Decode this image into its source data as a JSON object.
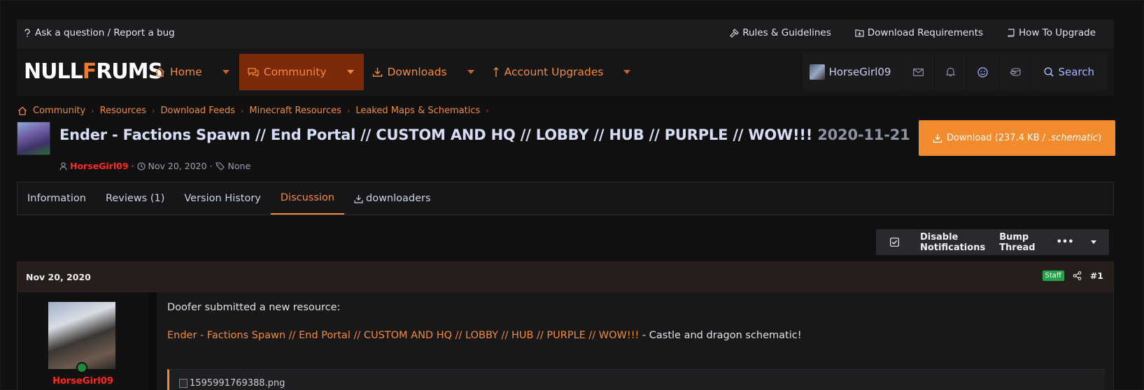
{
  "topbar": {
    "ask": "Ask a question / Report a bug",
    "links": [
      "Rules & Guidelines",
      "Download Requirements",
      "How To Upgrade"
    ]
  },
  "logo": {
    "part1": "NULL",
    "part2": "F",
    "part3": "RUMS"
  },
  "nav": {
    "items": [
      {
        "label": "Home"
      },
      {
        "label": "Community"
      },
      {
        "label": "Downloads"
      },
      {
        "label": "Account Upgrades"
      }
    ],
    "username": "HorseGirl09",
    "search": "Search"
  },
  "breadcrumb": [
    "Community",
    "Resources",
    "Download Feeds",
    "Minecraft Resources",
    "Leaked Maps & Schematics"
  ],
  "resource": {
    "title": "Ender - Factions Spawn // End Portal // CUSTOM AND HQ // LOBBY // HUB // PURPLE // WOW!!!",
    "version": "2020-11-21",
    "author": "HorseGirl09",
    "date": "Nov 20, 2020",
    "tags": "None",
    "download_prefix": "Download (237.4 KB / ",
    "download_ext": ".schematic",
    "download_suffix": ")"
  },
  "tabs": [
    "Information",
    "Reviews (1)",
    "Version History",
    "Discussion",
    "downloaders"
  ],
  "actions": {
    "disable": "Disable Notifications",
    "bump": "Bump Thread",
    "more": "•••"
  },
  "post": {
    "date": "Nov 20, 2020",
    "badge": "Staff",
    "number": "#1",
    "author": "HorseGirl09",
    "intro": "Doofer submitted a new resource:",
    "link": "Ender - Factions Spawn // End Portal // CUSTOM AND HQ // LOBBY // HUB // PURPLE // WOW!!!",
    "desc": " - Castle and dragon schematic!",
    "image_alt": "1595991769388.png"
  },
  "colors": {
    "accent": "#f28a2e",
    "author": "#ff2a1a",
    "staff": "#24a14a"
  }
}
